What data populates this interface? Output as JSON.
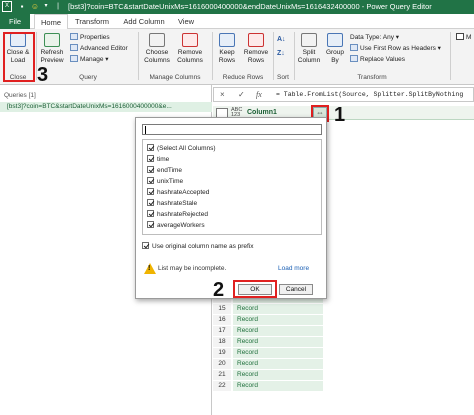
{
  "window": {
    "title": "[bst3]?coin=BTC&startDateUnixMs=1616000400000&endDateUnixMs=1616432400000 - Power Query Editor",
    "quick_access": [
      "save-icon",
      "smiley-icon",
      "dropdown-icon"
    ]
  },
  "tabs": [
    {
      "label": "File"
    },
    {
      "label": "Home"
    },
    {
      "label": "Transform"
    },
    {
      "label": "Add Column"
    },
    {
      "label": "View"
    }
  ],
  "ribbon": {
    "close_group": {
      "close_load_line1": "Close &",
      "close_load_line2": "Load",
      "label": "Close"
    },
    "query_group": {
      "refresh_line1": "Refresh",
      "refresh_line2": "Preview",
      "properties": "Properties",
      "advanced_editor": "Advanced Editor",
      "manage": "Manage",
      "label": "Query"
    },
    "columns_group": {
      "choose_line1": "Choose",
      "choose_line2": "Columns",
      "remove_line1": "Remove",
      "remove_line2": "Columns",
      "label": "Manage Columns"
    },
    "rows_group": {
      "keep_line1": "Keep",
      "keep_line2": "Rows",
      "remove_line1": "Remove",
      "remove_line2": "Rows",
      "label": "Reduce Rows"
    },
    "sort_group": {
      "label": "Sort"
    },
    "transform_group": {
      "split_line1": "Split",
      "split_line2": "Column",
      "group_line1": "Group",
      "group_line2": "By",
      "data_type": "Data Type: Any",
      "first_row": "Use First Row as Headers",
      "replace": "Replace Values",
      "label": "Transform"
    },
    "overflow_label": "M"
  },
  "annotations": {
    "one": "1",
    "two": "2",
    "three": "3"
  },
  "queries_pane": {
    "header": "Queries [1]",
    "items": [
      {
        "label": "[bst3]?coin=BTC&startDateUnixMs=1616000400000&e..."
      }
    ]
  },
  "formula_bar": {
    "cancel": "×",
    "confirm": "✓",
    "fx": "fx",
    "formula": "= Table.FromList(Source, Splitter.SplitByNothing"
  },
  "grid": {
    "column_header": "Column1",
    "type_label_top": "ABC",
    "type_label_bottom": "123",
    "rows": [
      {
        "num": "14",
        "value": "Record"
      },
      {
        "num": "15",
        "value": "Record"
      },
      {
        "num": "16",
        "value": "Record"
      },
      {
        "num": "17",
        "value": "Record"
      },
      {
        "num": "18",
        "value": "Record"
      },
      {
        "num": "19",
        "value": "Record"
      },
      {
        "num": "20",
        "value": "Record"
      },
      {
        "num": "21",
        "value": "Record"
      },
      {
        "num": "22",
        "value": "Record"
      }
    ]
  },
  "dialog": {
    "search_value": "",
    "columns": [
      {
        "label": "(Select All Columns)",
        "checked": true
      },
      {
        "label": "time",
        "checked": true
      },
      {
        "label": "endTime",
        "checked": true
      },
      {
        "label": "unixTime",
        "checked": true
      },
      {
        "label": "hashrateAccepted",
        "checked": true
      },
      {
        "label": "hashrateStale",
        "checked": true
      },
      {
        "label": "hashrateRejected",
        "checked": true
      },
      {
        "label": "averageWorkers",
        "checked": true
      }
    ],
    "prefix_label": "Use original column name as prefix",
    "prefix_checked": true,
    "warning": "List may be incomplete.",
    "load_more": "Load more",
    "ok": "OK",
    "cancel": "Cancel"
  },
  "colors": {
    "excel_green": "#217346",
    "annotation_red": "#e02020",
    "record_green": "#1e6f3b",
    "selected_row_bg": "#dff0e4"
  }
}
